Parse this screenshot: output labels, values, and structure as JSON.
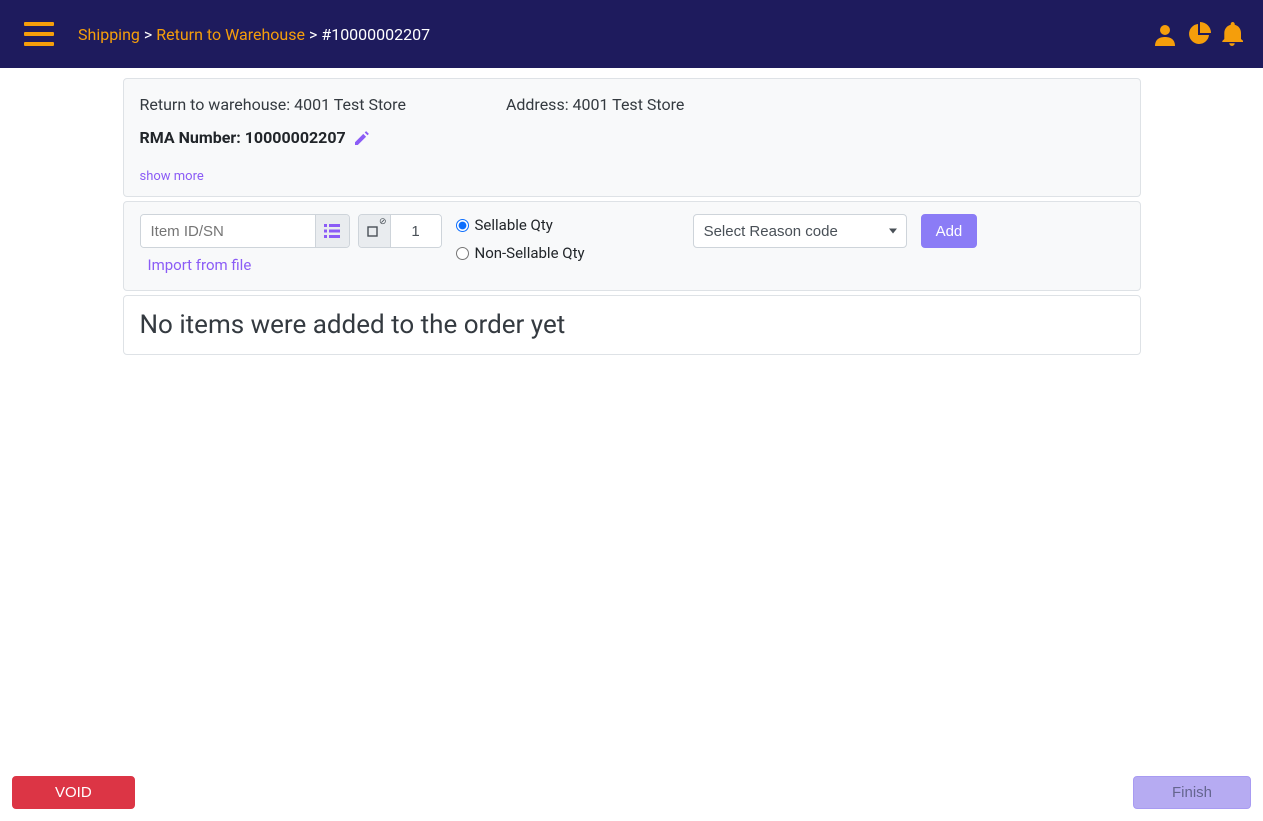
{
  "breadcrumb": {
    "level1": "Shipping",
    "level2": "Return to Warehouse",
    "current": "#10000002207"
  },
  "info": {
    "return_label": "Return to warehouse:",
    "return_value": "4001 Test Store",
    "address_label": "Address:",
    "address_value": "4001 Test Store",
    "rma_label": "RMA Number:",
    "rma_value": "10000002207",
    "show_more": "show more"
  },
  "form": {
    "item_placeholder": "Item ID/SN",
    "qty_value": "1",
    "import_link": "Import from file",
    "radio_sellable": "Sellable Qty",
    "radio_nonsellable": "Non-Sellable Qty",
    "reason_placeholder": "Select Reason code",
    "add_button": "Add"
  },
  "empty_message": "No items were added to the order yet",
  "footer": {
    "void": "VOID",
    "finish": "Finish"
  }
}
